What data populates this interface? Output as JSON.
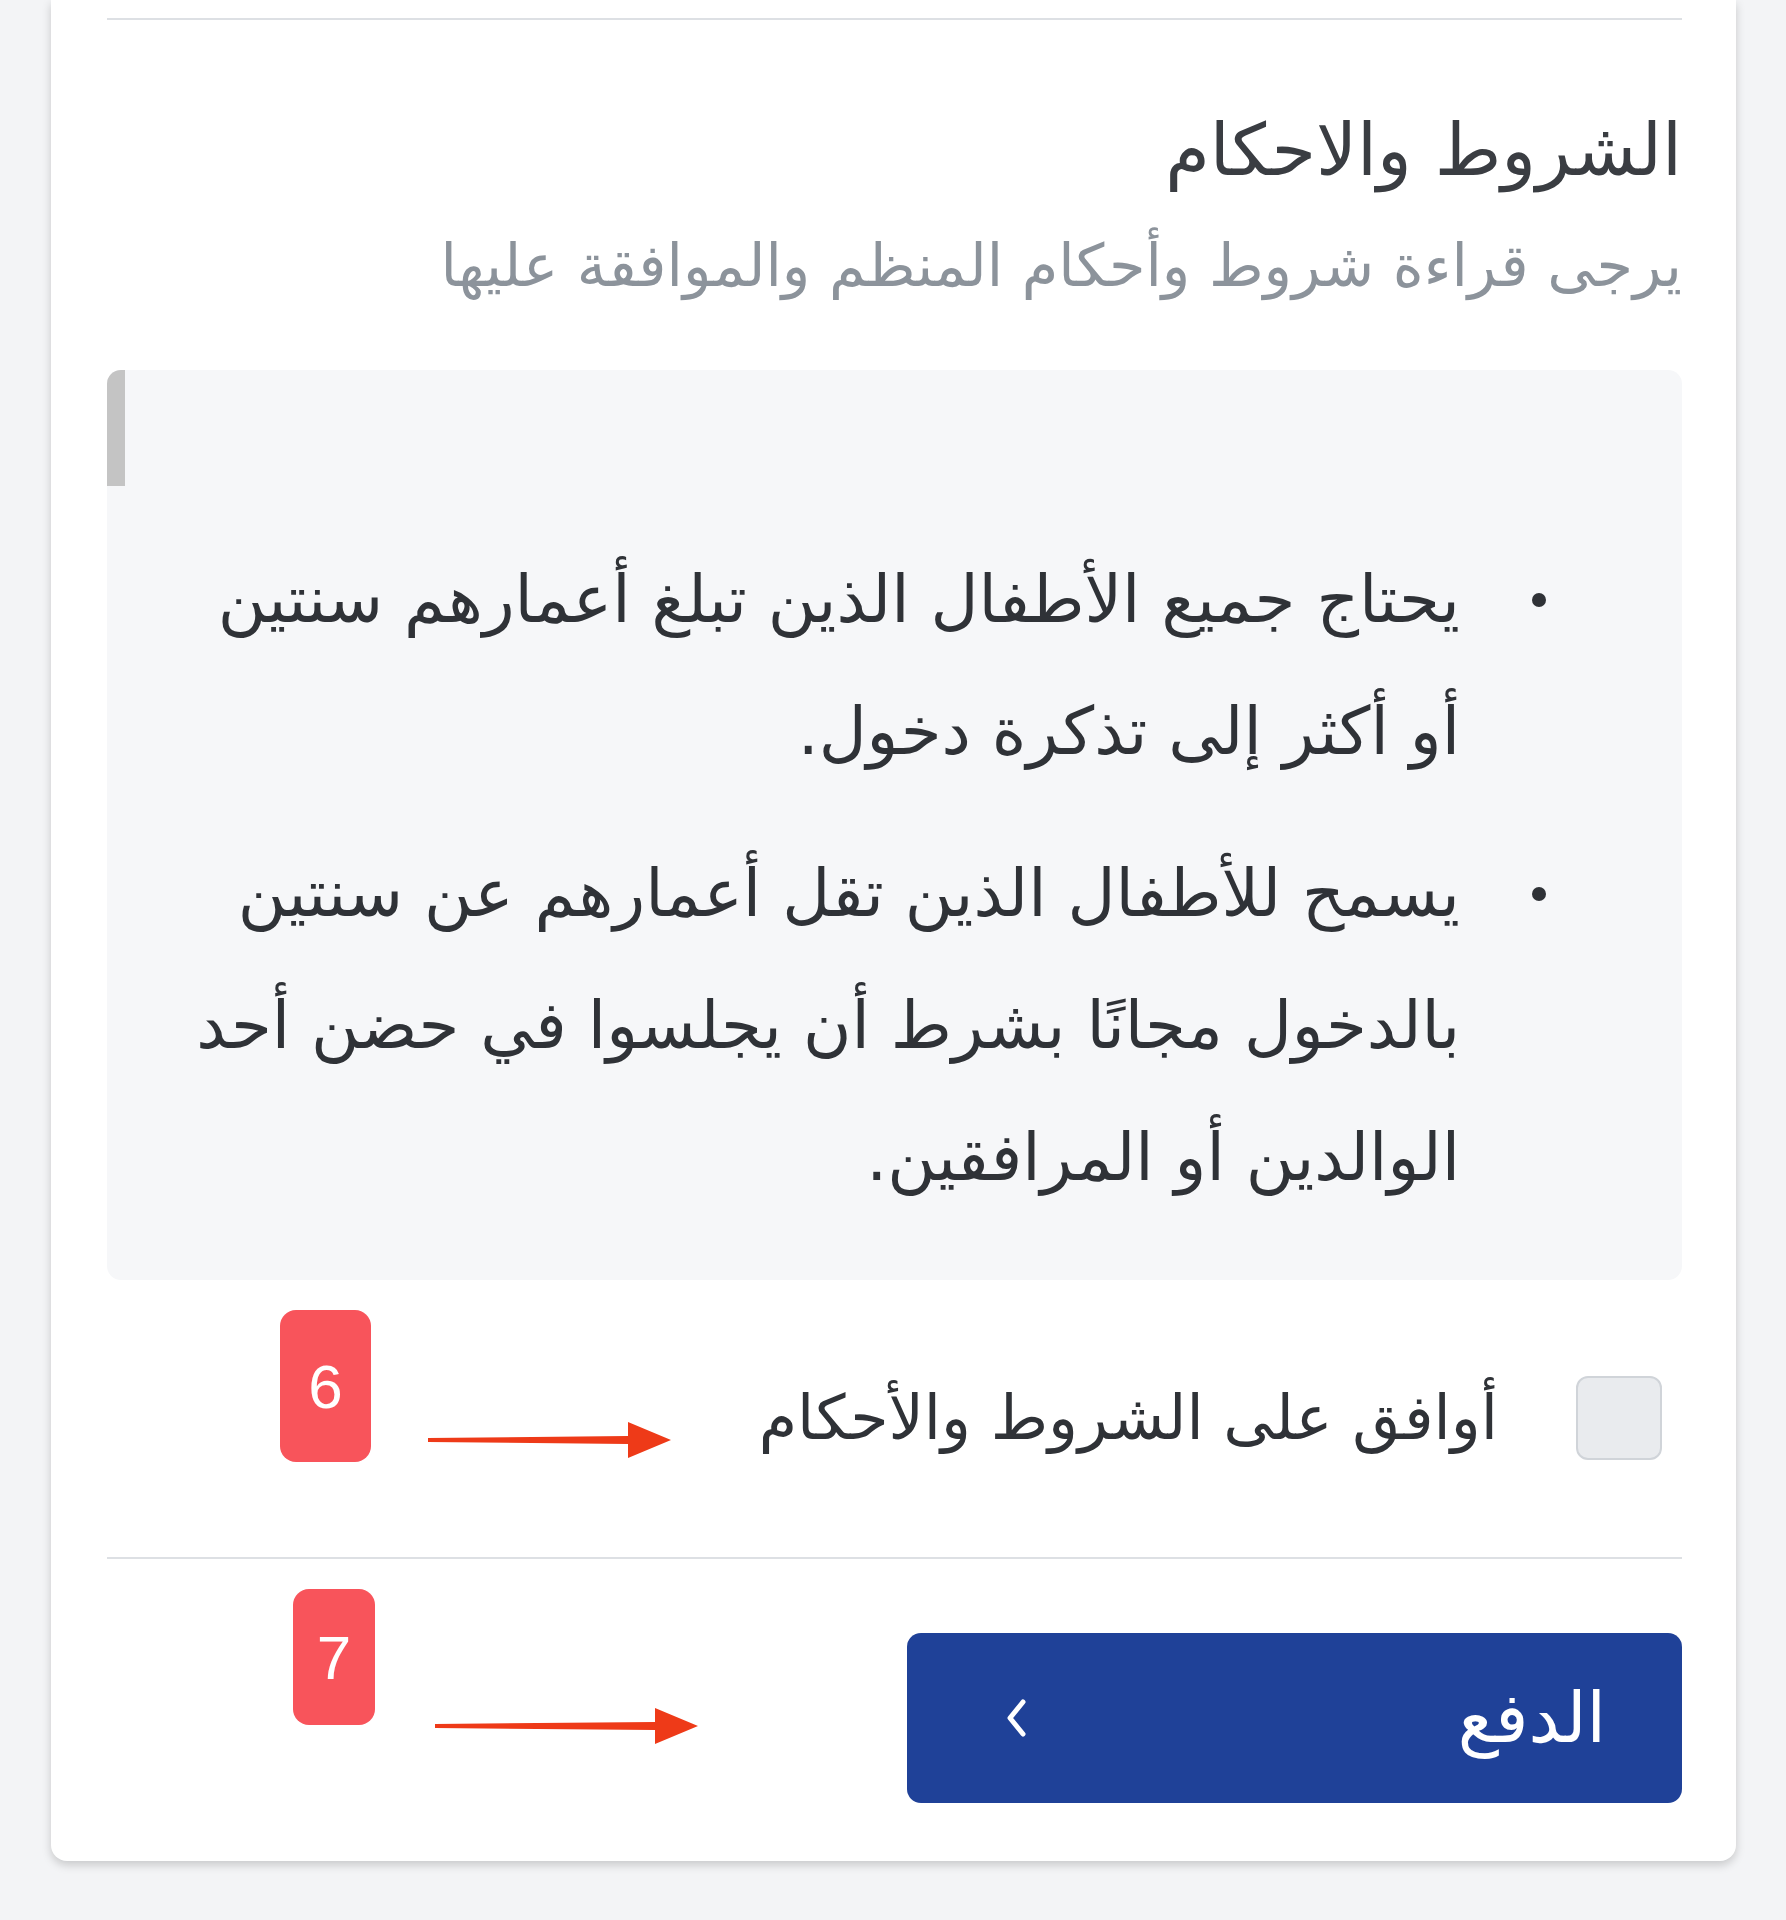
{
  "header": {
    "title": "الشروط والاحكام",
    "subtitle": "يرجى قراءة شروط وأحكام المنظم والموافقة عليها"
  },
  "terms": {
    "items": [
      "يحتاج جميع الأطفال الذين تبلغ أعمارهم سنتين أو أكثر إلى تذكرة دخول.",
      "يسمح للأطفال الذين تقل أعمارهم عن سنتين بالدخول مجانًا بشرط أن يجلسوا في حضن أحد الوالدين أو المرافقين."
    ]
  },
  "agreement": {
    "label": "أوافق على الشروط والأحكام",
    "checked": false
  },
  "pay_button": {
    "label": "الدفع"
  },
  "annotations": [
    {
      "label": "6"
    },
    {
      "label": "7"
    }
  ]
}
